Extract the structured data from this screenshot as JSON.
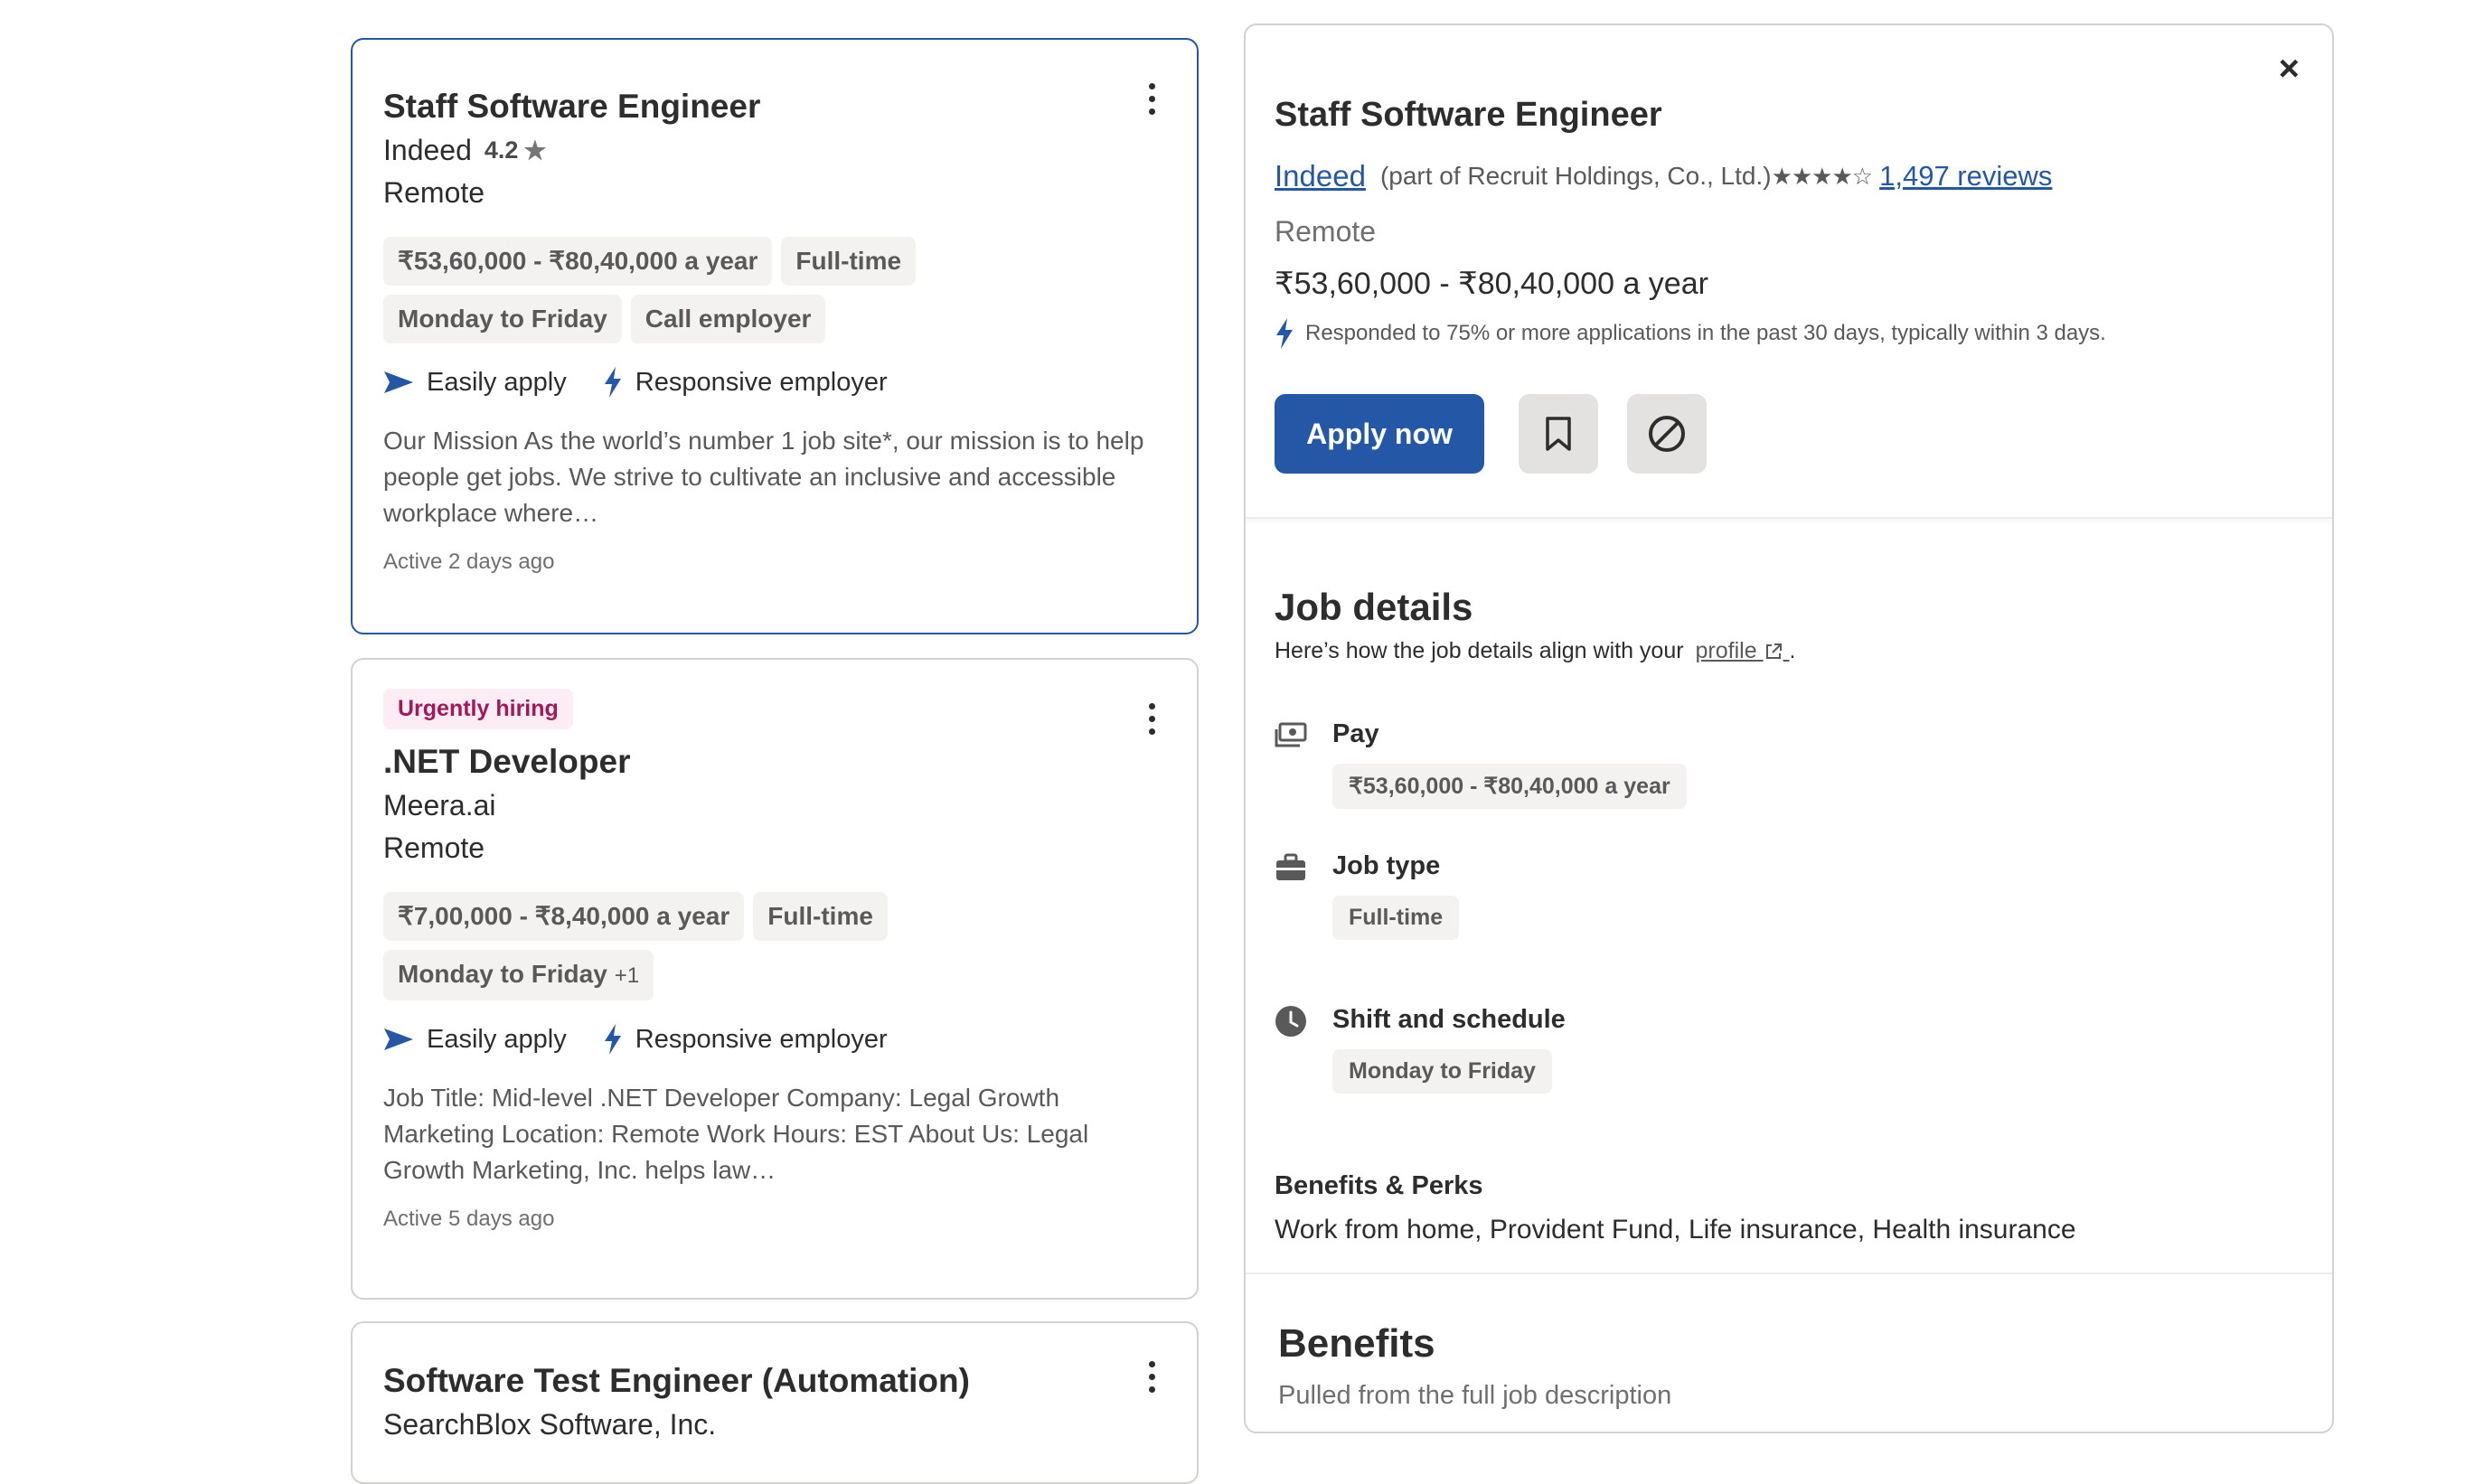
{
  "jobs": [
    {
      "title": "Staff Software Engineer",
      "company": "Indeed",
      "rating": "4.2",
      "location": "Remote",
      "tags": [
        "₹53,60,000 - ₹80,40,000 a year",
        "Full-time",
        "Monday to Friday",
        "Call employer"
      ],
      "features": [
        "Easily apply",
        "Responsive employer"
      ],
      "snippet": "Our Mission As the world’s number 1 job site*, our mission is to help people get jobs. We strive to cultivate an inclusive and accessible workplace where…",
      "active": "Active 2 days ago"
    },
    {
      "badge": "Urgently hiring",
      "title": ".NET Developer",
      "company": "Meera.ai",
      "location": "Remote",
      "tags": [
        "₹7,00,000 - ₹8,40,000 a year",
        "Full-time",
        "Monday to Friday"
      ],
      "extra_tag_count": "+1",
      "features": [
        "Easily apply",
        "Responsive employer"
      ],
      "snippet": "Job Title: Mid-level .NET Developer Company: Legal Growth Marketing Location: Remote Work Hours: EST About Us: Legal Growth Marketing, Inc. helps law…",
      "active": "Active 5 days ago"
    },
    {
      "title": "Software Test Engineer (Automation)",
      "company": "SearchBlox Software, Inc."
    }
  ],
  "detail": {
    "close": "×",
    "title": "Staff Software Engineer",
    "company": "Indeed",
    "parent": "(part of Recruit Holdings, Co., Ltd.)",
    "stars": "★★★★☆",
    "reviews": "1,497 reviews",
    "location": "Remote",
    "salary": "₹53,60,000 - ₹80,40,000 a year",
    "responsive_note": "Responded to 75% or more applications in the past 30 days, typically within 3 days.",
    "apply_label": "Apply now",
    "job_details_title": "Job details",
    "job_details_sub": "Here’s how the job details align with your",
    "profile_link": "profile",
    "period": ".",
    "pay_label": "Pay",
    "pay_value": "₹53,60,000 - ₹80,40,000 a year",
    "jobtype_label": "Job type",
    "jobtype_value": "Full-time",
    "shift_label": "Shift and schedule",
    "shift_value": "Monday to Friday",
    "benefits_perks_title": "Benefits & Perks",
    "benefits_perks_text": "Work from home, Provident Fund, Life insurance, Health insurance",
    "benefits_title": "Benefits",
    "benefits_sub": "Pulled from the full job description"
  },
  "colors": {
    "brand": "#2557a7",
    "urgent_bg": "#fcedf4",
    "urgent_text": "#a2185a",
    "tag_bg": "#f3f2f1"
  }
}
